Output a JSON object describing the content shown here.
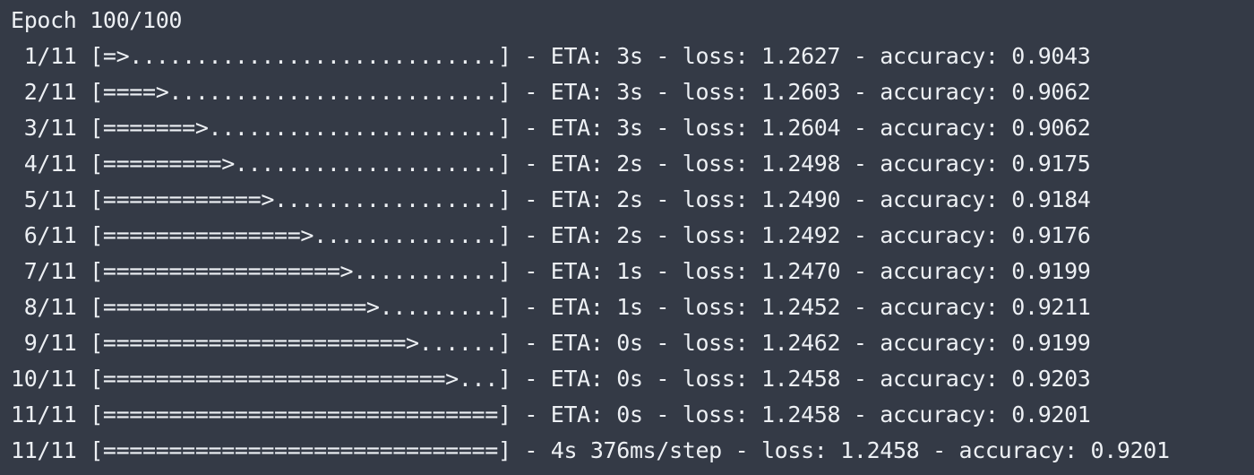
{
  "terminal": {
    "lines": [
      "Epoch 100/100",
      " 1/11 [=>............................] - ETA: 3s - loss: 1.2627 - accuracy: 0.9043",
      " 2/11 [====>.........................] - ETA: 3s - loss: 1.2603 - accuracy: 0.9062",
      " 3/11 [=======>......................] - ETA: 3s - loss: 1.2604 - accuracy: 0.9062",
      " 4/11 [=========>....................] - ETA: 2s - loss: 1.2498 - accuracy: 0.9175",
      " 5/11 [============>.................] - ETA: 2s - loss: 1.2490 - accuracy: 0.9184",
      " 6/11 [===============>..............] - ETA: 2s - loss: 1.2492 - accuracy: 0.9176",
      " 7/11 [==================>...........] - ETA: 1s - loss: 1.2470 - accuracy: 0.9199",
      " 8/11 [====================>.........] - ETA: 1s - loss: 1.2452 - accuracy: 0.9211",
      " 9/11 [=======================>......] - ETA: 0s - loss: 1.2462 - accuracy: 0.9199",
      "10/11 [==========================>...] - ETA: 0s - loss: 1.2458 - accuracy: 0.9203",
      "11/11 [==============================] - ETA: 0s - loss: 1.2458 - accuracy: 0.9201",
      "11/11 [==============================] - 4s 376ms/step - loss: 1.2458 - accuracy: 0.9201"
    ]
  },
  "colors": {
    "background": "#343a46",
    "text": "#edf0f4"
  }
}
